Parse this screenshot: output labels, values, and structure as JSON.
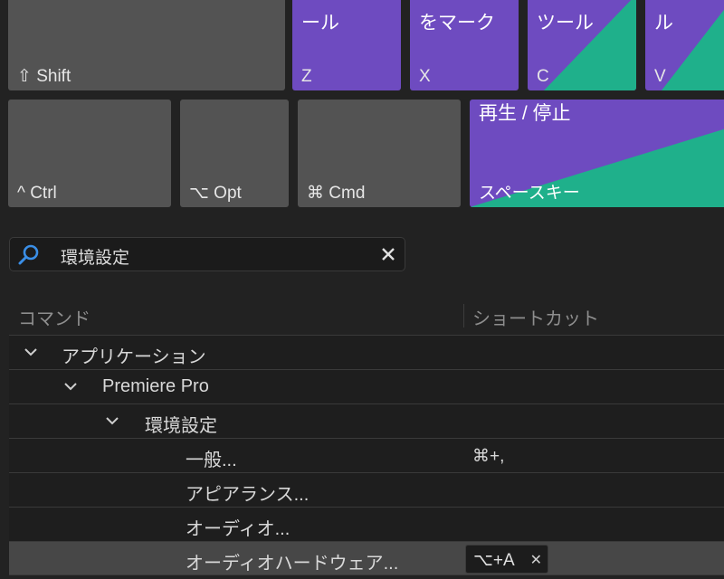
{
  "keys": {
    "shift": "⇧ Shift",
    "z": {
      "top": "ール",
      "letter": "Z"
    },
    "x": {
      "top": "をマーク",
      "letter": "X"
    },
    "c": {
      "top": "ツール",
      "letter": "C"
    },
    "v": {
      "top": "ル",
      "letter": "V"
    },
    "ctrl": "^ Ctrl",
    "opt": "⌥ Opt",
    "cmd": "⌘ Cmd",
    "space": {
      "top": "再生 / 停止",
      "bottom": "スペースキー"
    }
  },
  "colors": {
    "purple": "#6e4bc0",
    "green": "#1fb08b",
    "key": "#535353"
  },
  "search": {
    "value": "環境設定",
    "icon": "search-icon"
  },
  "columns": {
    "command": "コマンド",
    "shortcut": "ショートカット"
  },
  "tree": {
    "app": "アプリケーション",
    "premiere": "Premiere Pro",
    "prefs": "環境設定",
    "general": "一般...",
    "general_sc": "⌘+,",
    "appearance": "アピアランス...",
    "audio": "オーディオ...",
    "audio_hw": "オーディオハードウェア...",
    "audio_hw_sc": "⌥+A"
  }
}
